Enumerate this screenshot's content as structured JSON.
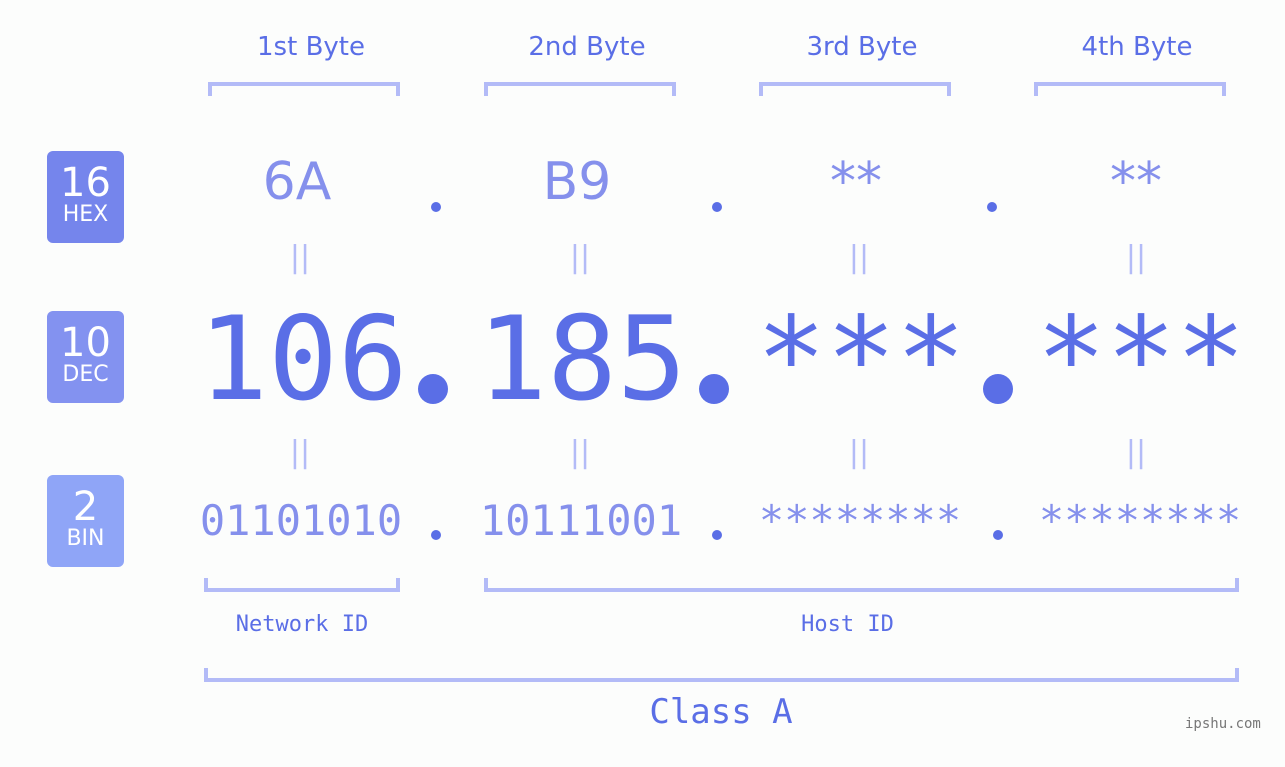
{
  "bytes": [
    {
      "header": "1st Byte",
      "hex": "6A",
      "dec": "106",
      "bin": "01101010"
    },
    {
      "header": "2nd Byte",
      "hex": "B9",
      "dec": "185",
      "bin": "10111001"
    },
    {
      "header": "3rd Byte",
      "hex": "**",
      "dec": "***",
      "bin": "********"
    },
    {
      "header": "4th Byte",
      "hex": "**",
      "dec": "***",
      "bin": "********"
    }
  ],
  "badges": {
    "hex": {
      "num": "16",
      "label": "HEX",
      "color": "#7585ec"
    },
    "dec": {
      "num": "10",
      "label": "DEC",
      "color": "#8392f0"
    },
    "bin": {
      "num": "2",
      "label": "BIN",
      "color": "#8fa5f7"
    }
  },
  "equals_symbol": "||",
  "labels": {
    "network_id": "Network ID",
    "host_id": "Host ID",
    "class": "Class A"
  },
  "watermark": "ipshu.com",
  "colors": {
    "primary": "#5a6ee6",
    "secondary": "#8590ec",
    "bracket": "#b3bbf7",
    "background": "#fcfdfc"
  }
}
